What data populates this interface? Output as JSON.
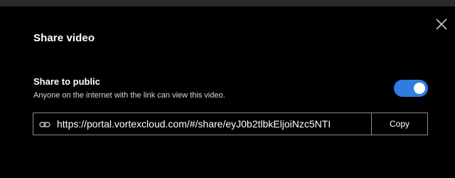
{
  "dialog": {
    "title": "Share video",
    "close_icon": "close-icon"
  },
  "share_public": {
    "title": "Share to public",
    "description": "Anyone on the internet with the link can view this video.",
    "toggle_on": true,
    "toggle_color": "#2f7de1"
  },
  "link": {
    "icon": "link-icon",
    "url": "https://portal.vortexcloud.com/#/share/eyJ0b2tlbkEljoiNzc5NTI",
    "copy_label": "Copy"
  }
}
